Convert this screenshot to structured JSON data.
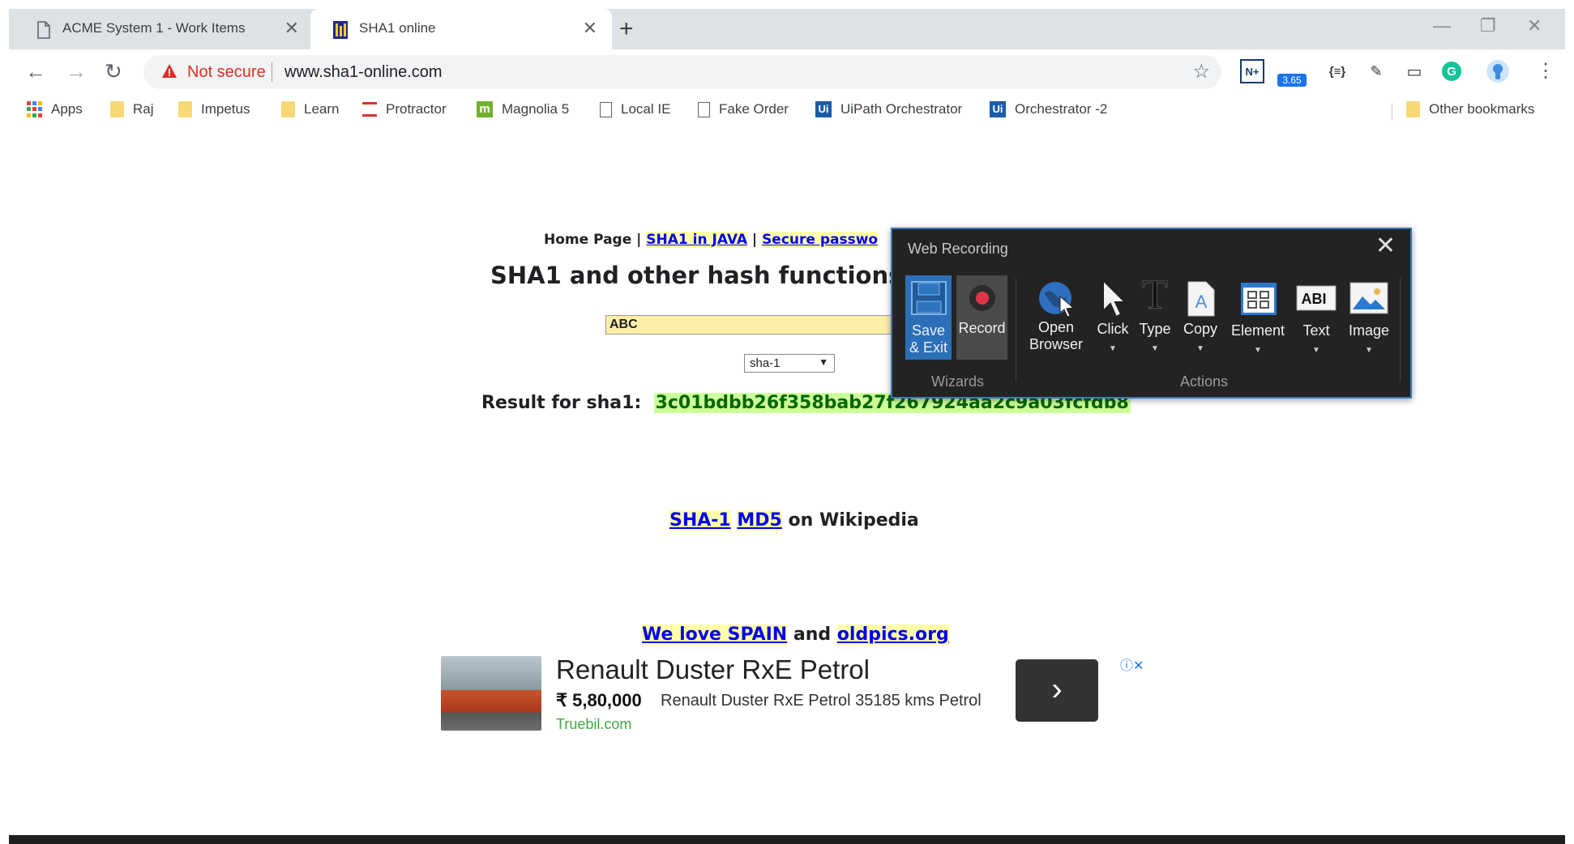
{
  "browser": {
    "tabs": [
      {
        "title": "ACME System 1 - Work Items",
        "close": "✕"
      },
      {
        "title": "SHA1 online",
        "close": "✕"
      }
    ],
    "new_tab": "+",
    "window_controls": [
      "—",
      "❐",
      "✕"
    ],
    "nav": {
      "back": "←",
      "forward": "→",
      "reload": "↻"
    },
    "address": {
      "security": "Not secure",
      "url": "www.sha1-online.com",
      "star": "☆"
    },
    "extensions": [
      {
        "name": "N+",
        "icon": "n-plus-icon"
      },
      {
        "name": "3.65",
        "icon": "speed-badge-icon"
      },
      {
        "name": "{≡}",
        "icon": "json-icon"
      },
      {
        "name": "✎",
        "icon": "eraser-icon"
      },
      {
        "name": "▭",
        "icon": "cast-icon"
      },
      {
        "name": "G",
        "icon": "grammarly-icon"
      }
    ],
    "menu": "⋮",
    "bookmarks": [
      {
        "label": "Apps",
        "icon": "apps"
      },
      {
        "label": "Raj",
        "icon": "folder"
      },
      {
        "label": "Impetus",
        "icon": "folder"
      },
      {
        "label": "Learn",
        "icon": "folder"
      },
      {
        "label": "Protractor",
        "icon": "protractor"
      },
      {
        "label": "Magnolia 5",
        "icon": "magnolia"
      },
      {
        "label": "Local IE",
        "icon": "doc"
      },
      {
        "label": "Fake Order",
        "icon": "doc"
      },
      {
        "label": "UiPath Orchestrator",
        "icon": "uipath"
      },
      {
        "label": "Orchestrator -2",
        "icon": "uipath"
      }
    ],
    "other_bookmarks": "Other bookmarks"
  },
  "page": {
    "topnav": {
      "home": "Home Page",
      "sep": " | ",
      "java": "SHA1 in JAVA",
      "secure": "Secure passwo"
    },
    "title": "SHA1 and other hash functions",
    "input_value": "ABC",
    "algorithm": "sha-1",
    "result_label": "Result for sha1:",
    "result_hash": "3c01bdbb26f358bab27f267924aa2c9a03fcfdb8",
    "wiki": {
      "sha1": "SHA-1",
      "md5": "MD5",
      "suffix": " on Wikipedia"
    },
    "promo": {
      "spain": "We love SPAIN",
      "and": " and ",
      "oldpics": "oldpics.org"
    },
    "ad": {
      "title": "Renault Duster RxE Petrol",
      "price": "₹ 5,80,000",
      "description": "Renault Duster RxE Petrol 35185 kms Petrol",
      "domain": "Truebil.com",
      "go": "›",
      "info": "ⓘ✕"
    }
  },
  "recorder": {
    "title": "Web Recording",
    "close": "✕",
    "wizards_label": "Wizards",
    "actions_label": "Actions",
    "buttons": {
      "save": "Save & Exit",
      "record": "Record",
      "open_browser": "Open Browser",
      "click": "Click",
      "type": "Type",
      "copy": "Copy",
      "element": "Element",
      "text": "Text",
      "image": "Image"
    }
  }
}
